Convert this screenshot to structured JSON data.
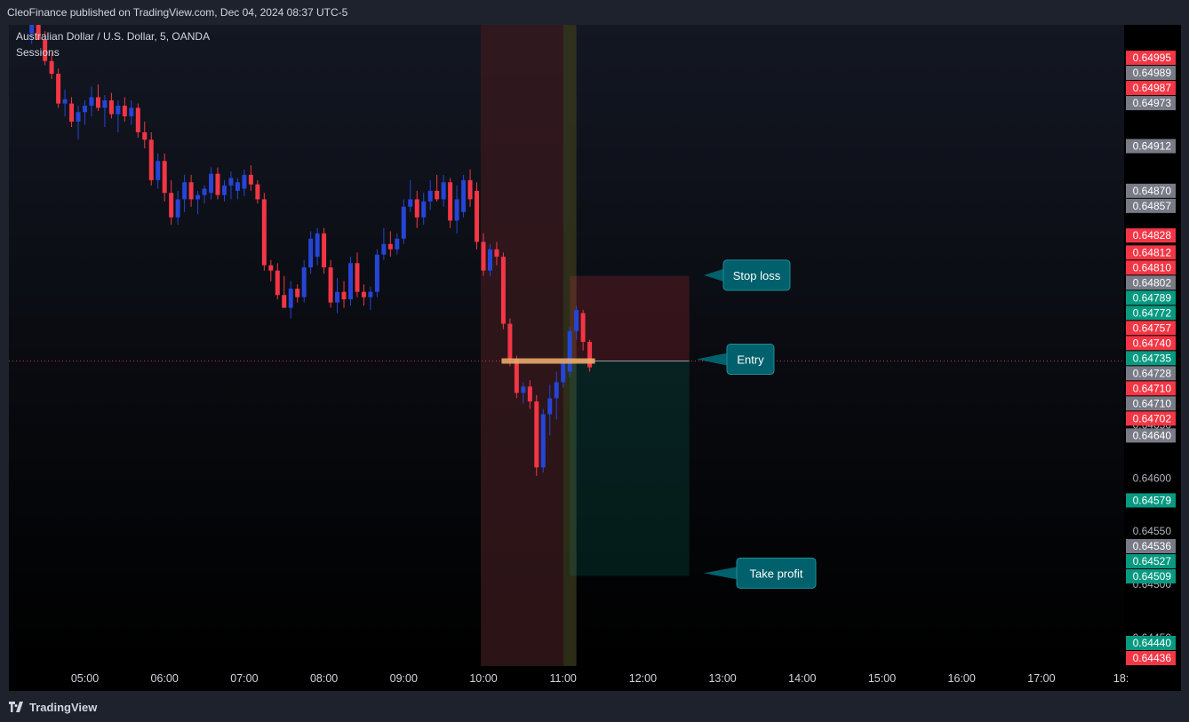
{
  "header": {
    "published": "CleoFinance published on TradingView.com, Dec 04, 2024 08:37 UTC-5"
  },
  "legend": {
    "symbol": "Australian Dollar / U.S. Dollar, 5, OANDA",
    "indicator": "Sessions"
  },
  "footer": {
    "brand": "TradingView"
  },
  "colors": {
    "up": "#2545d6",
    "down": "#f23645",
    "background_top": "#131722",
    "background_bottom": "#000000",
    "annotation": "#00606b",
    "price_gray": "#787b86",
    "price_red": "#f23645",
    "price_green": "#089981"
  },
  "chart_data": {
    "type": "candlestick",
    "symbol": "Australian Dollar / U.S. Dollar",
    "interval_minutes": 5,
    "ylim": [
      0.6443,
      0.6503
    ],
    "x_ticks": [
      "05:00",
      "06:00",
      "07:00",
      "08:00",
      "09:00",
      "10:00",
      "11:00",
      "12:00",
      "13:00",
      "14:00",
      "15:00",
      "16:00",
      "17:00",
      "18:"
    ],
    "y_ticks": [
      "0.64950",
      "0.64650",
      "0.64600",
      "0.64550",
      "0.64500",
      "0.64450"
    ],
    "candles": [
      {
        "t": "04:20",
        "o": 0.65018,
        "h": 0.65032,
        "l": 0.65008,
        "c": 0.65027
      },
      {
        "t": "04:25",
        "o": 0.6503,
        "h": 0.6504,
        "l": 0.65015,
        "c": 0.65012
      },
      {
        "t": "04:30",
        "o": 0.65012,
        "h": 0.6502,
        "l": 0.64988,
        "c": 0.64992
      },
      {
        "t": "04:35",
        "o": 0.64992,
        "h": 0.65,
        "l": 0.64975,
        "c": 0.6498
      },
      {
        "t": "04:40",
        "o": 0.6498,
        "h": 0.64985,
        "l": 0.64948,
        "c": 0.64952
      },
      {
        "t": "04:45",
        "o": 0.64952,
        "h": 0.64965,
        "l": 0.6494,
        "c": 0.64956
      },
      {
        "t": "04:50",
        "o": 0.64952,
        "h": 0.64958,
        "l": 0.6493,
        "c": 0.64935
      },
      {
        "t": "04:55",
        "o": 0.64935,
        "h": 0.6495,
        "l": 0.64918,
        "c": 0.64944
      },
      {
        "t": "05:00",
        "o": 0.64944,
        "h": 0.64955,
        "l": 0.64932,
        "c": 0.6495
      },
      {
        "t": "05:05",
        "o": 0.6495,
        "h": 0.64968,
        "l": 0.6494,
        "c": 0.64958
      },
      {
        "t": "05:10",
        "o": 0.64958,
        "h": 0.6497,
        "l": 0.64945,
        "c": 0.64948
      },
      {
        "t": "05:15",
        "o": 0.64948,
        "h": 0.6496,
        "l": 0.6493,
        "c": 0.64955
      },
      {
        "t": "05:20",
        "o": 0.64955,
        "h": 0.64962,
        "l": 0.64938,
        "c": 0.64942
      },
      {
        "t": "05:25",
        "o": 0.64942,
        "h": 0.64955,
        "l": 0.64925,
        "c": 0.6495
      },
      {
        "t": "05:30",
        "o": 0.6495,
        "h": 0.64958,
        "l": 0.64935,
        "c": 0.6494
      },
      {
        "t": "05:35",
        "o": 0.6494,
        "h": 0.64955,
        "l": 0.64932,
        "c": 0.64948
      },
      {
        "t": "05:40",
        "o": 0.64948,
        "h": 0.64952,
        "l": 0.6492,
        "c": 0.64925
      },
      {
        "t": "05:45",
        "o": 0.64925,
        "h": 0.64935,
        "l": 0.6491,
        "c": 0.64918
      },
      {
        "t": "05:50",
        "o": 0.64918,
        "h": 0.64925,
        "l": 0.64875,
        "c": 0.6488
      },
      {
        "t": "05:55",
        "o": 0.6488,
        "h": 0.64905,
        "l": 0.64872,
        "c": 0.64898
      },
      {
        "t": "06:00",
        "o": 0.64898,
        "h": 0.64905,
        "l": 0.6486,
        "c": 0.64868
      },
      {
        "t": "06:05",
        "o": 0.64868,
        "h": 0.6488,
        "l": 0.64838,
        "c": 0.64845
      },
      {
        "t": "06:10",
        "o": 0.64845,
        "h": 0.6487,
        "l": 0.64838,
        "c": 0.64862
      },
      {
        "t": "06:15",
        "o": 0.64862,
        "h": 0.64885,
        "l": 0.6485,
        "c": 0.64878
      },
      {
        "t": "06:20",
        "o": 0.64878,
        "h": 0.64885,
        "l": 0.64855,
        "c": 0.64862
      },
      {
        "t": "06:25",
        "o": 0.64862,
        "h": 0.6487,
        "l": 0.64848,
        "c": 0.64866
      },
      {
        "t": "06:30",
        "o": 0.64866,
        "h": 0.64875,
        "l": 0.64858,
        "c": 0.64872
      },
      {
        "t": "06:35",
        "o": 0.64868,
        "h": 0.64892,
        "l": 0.64862,
        "c": 0.64886
      },
      {
        "t": "06:40",
        "o": 0.64886,
        "h": 0.64892,
        "l": 0.64862,
        "c": 0.64866
      },
      {
        "t": "06:45",
        "o": 0.64866,
        "h": 0.6488,
        "l": 0.6486,
        "c": 0.64875
      },
      {
        "t": "06:50",
        "o": 0.64875,
        "h": 0.64888,
        "l": 0.64862,
        "c": 0.64882
      },
      {
        "t": "06:55",
        "o": 0.6487,
        "h": 0.64882,
        "l": 0.64862,
        "c": 0.64878
      },
      {
        "t": "07:00",
        "o": 0.64872,
        "h": 0.6489,
        "l": 0.64865,
        "c": 0.64885
      },
      {
        "t": "07:05",
        "o": 0.64885,
        "h": 0.64894,
        "l": 0.6487,
        "c": 0.64876
      },
      {
        "t": "07:10",
        "o": 0.64876,
        "h": 0.6488,
        "l": 0.64858,
        "c": 0.64862
      },
      {
        "t": "07:15",
        "o": 0.64862,
        "h": 0.64868,
        "l": 0.64795,
        "c": 0.648
      },
      {
        "t": "07:20",
        "o": 0.648,
        "h": 0.64805,
        "l": 0.64785,
        "c": 0.64795
      },
      {
        "t": "07:25",
        "o": 0.64795,
        "h": 0.64802,
        "l": 0.64768,
        "c": 0.64772
      },
      {
        "t": "07:30",
        "o": 0.64772,
        "h": 0.6479,
        "l": 0.64765,
        "c": 0.6476
      },
      {
        "t": "07:35",
        "o": 0.6476,
        "h": 0.64785,
        "l": 0.6475,
        "c": 0.64778
      },
      {
        "t": "07:40",
        "o": 0.64778,
        "h": 0.64782,
        "l": 0.64765,
        "c": 0.6477
      },
      {
        "t": "07:45",
        "o": 0.6477,
        "h": 0.64805,
        "l": 0.64765,
        "c": 0.64798
      },
      {
        "t": "07:50",
        "o": 0.64798,
        "h": 0.64832,
        "l": 0.64792,
        "c": 0.64825
      },
      {
        "t": "07:55",
        "o": 0.64808,
        "h": 0.64835,
        "l": 0.648,
        "c": 0.6483
      },
      {
        "t": "08:00",
        "o": 0.6483,
        "h": 0.64835,
        "l": 0.64792,
        "c": 0.64798
      },
      {
        "t": "08:05",
        "o": 0.64798,
        "h": 0.64805,
        "l": 0.6476,
        "c": 0.64765
      },
      {
        "t": "08:10",
        "o": 0.64765,
        "h": 0.64788,
        "l": 0.64755,
        "c": 0.64775
      },
      {
        "t": "08:15",
        "o": 0.64775,
        "h": 0.64785,
        "l": 0.6476,
        "c": 0.64768
      },
      {
        "t": "08:20",
        "o": 0.64768,
        "h": 0.64808,
        "l": 0.64762,
        "c": 0.64802
      },
      {
        "t": "08:25",
        "o": 0.64802,
        "h": 0.64812,
        "l": 0.6477,
        "c": 0.64775
      },
      {
        "t": "08:30",
        "o": 0.64775,
        "h": 0.64782,
        "l": 0.64762,
        "c": 0.6477
      },
      {
        "t": "08:35",
        "o": 0.6477,
        "h": 0.6478,
        "l": 0.64758,
        "c": 0.64775
      },
      {
        "t": "08:40",
        "o": 0.64775,
        "h": 0.64815,
        "l": 0.6477,
        "c": 0.6481
      },
      {
        "t": "08:45",
        "o": 0.6481,
        "h": 0.64835,
        "l": 0.64805,
        "c": 0.6482
      },
      {
        "t": "08:50",
        "o": 0.6482,
        "h": 0.64832,
        "l": 0.64808,
        "c": 0.64815
      },
      {
        "t": "08:55",
        "o": 0.64815,
        "h": 0.6483,
        "l": 0.6481,
        "c": 0.64825
      },
      {
        "t": "09:00",
        "o": 0.64825,
        "h": 0.64862,
        "l": 0.6482,
        "c": 0.64855
      },
      {
        "t": "09:05",
        "o": 0.64855,
        "h": 0.6488,
        "l": 0.6485,
        "c": 0.64862
      },
      {
        "t": "09:10",
        "o": 0.64862,
        "h": 0.6487,
        "l": 0.64835,
        "c": 0.64845
      },
      {
        "t": "09:15",
        "o": 0.64845,
        "h": 0.64868,
        "l": 0.64838,
        "c": 0.6486
      },
      {
        "t": "09:20",
        "o": 0.6486,
        "h": 0.6488,
        "l": 0.64852,
        "c": 0.6487
      },
      {
        "t": "09:25",
        "o": 0.6487,
        "h": 0.64885,
        "l": 0.6486,
        "c": 0.64862
      },
      {
        "t": "09:30",
        "o": 0.64862,
        "h": 0.64885,
        "l": 0.64855,
        "c": 0.64878
      },
      {
        "t": "09:35",
        "o": 0.64878,
        "h": 0.64882,
        "l": 0.64835,
        "c": 0.64842
      },
      {
        "t": "09:40",
        "o": 0.64842,
        "h": 0.64875,
        "l": 0.6483,
        "c": 0.64862
      },
      {
        "t": "09:45",
        "o": 0.6485,
        "h": 0.64885,
        "l": 0.64845,
        "c": 0.6488
      },
      {
        "t": "09:50",
        "o": 0.6488,
        "h": 0.6489,
        "l": 0.64855,
        "c": 0.64862
      },
      {
        "t": "09:55",
        "o": 0.6487,
        "h": 0.64878,
        "l": 0.64815,
        "c": 0.64822
      },
      {
        "t": "10:00",
        "o": 0.64822,
        "h": 0.6483,
        "l": 0.6479,
        "c": 0.64795
      },
      {
        "t": "10:05",
        "o": 0.64795,
        "h": 0.6482,
        "l": 0.6479,
        "c": 0.64815
      },
      {
        "t": "10:10",
        "o": 0.64815,
        "h": 0.64822,
        "l": 0.648,
        "c": 0.64808
      },
      {
        "t": "10:15",
        "o": 0.64808,
        "h": 0.64812,
        "l": 0.6474,
        "c": 0.64745
      },
      {
        "t": "10:20",
        "o": 0.64745,
        "h": 0.6475,
        "l": 0.64705,
        "c": 0.64712
      },
      {
        "t": "10:25",
        "o": 0.64712,
        "h": 0.64715,
        "l": 0.64675,
        "c": 0.6468
      },
      {
        "t": "10:30",
        "o": 0.6468,
        "h": 0.6469,
        "l": 0.6467,
        "c": 0.64686
      },
      {
        "t": "10:35",
        "o": 0.64686,
        "h": 0.64692,
        "l": 0.64665,
        "c": 0.64672
      },
      {
        "t": "10:40",
        "o": 0.64672,
        "h": 0.64678,
        "l": 0.64602,
        "c": 0.6461
      },
      {
        "t": "10:45",
        "o": 0.6461,
        "h": 0.64665,
        "l": 0.64605,
        "c": 0.6466
      },
      {
        "t": "10:50",
        "o": 0.6466,
        "h": 0.64688,
        "l": 0.6464,
        "c": 0.64675
      },
      {
        "t": "10:55",
        "o": 0.64675,
        "h": 0.647,
        "l": 0.64655,
        "c": 0.6469
      },
      {
        "t": "11:00",
        "o": 0.6469,
        "h": 0.64712,
        "l": 0.64685,
        "c": 0.64708
      },
      {
        "t": "11:05",
        "o": 0.647,
        "h": 0.64742,
        "l": 0.64695,
        "c": 0.64738
      },
      {
        "t": "11:10",
        "o": 0.64738,
        "h": 0.64762,
        "l": 0.6473,
        "c": 0.64758
      },
      {
        "t": "11:15",
        "o": 0.64755,
        "h": 0.64758,
        "l": 0.6472,
        "c": 0.64728
      },
      {
        "t": "11:20",
        "o": 0.64728,
        "h": 0.6473,
        "l": 0.647,
        "c": 0.64704
      }
    ],
    "x_start": "04:20",
    "pixels_per_hour_note": "",
    "current_price": 0.6471,
    "position": {
      "entry": 0.6471,
      "stop_loss": 0.6479,
      "take_profit": 0.64508,
      "start": "11:05",
      "end": "12:35"
    },
    "sessions": [
      {
        "from": "09:58",
        "to": "11:00",
        "color": "#3a1a1e"
      },
      {
        "from": "11:00",
        "to": "11:10",
        "color": "#3a3a1e"
      }
    ],
    "annotations": [
      {
        "label": "Stop loss",
        "price": 0.64789
      },
      {
        "label": "Entry",
        "price": 0.6471
      },
      {
        "label": "Take profit",
        "price": 0.64509
      }
    ],
    "price_labels": [
      {
        "text": "0.64995",
        "color": "red"
      },
      {
        "text": "0.64989",
        "color": "gray"
      },
      {
        "text": "0.64987",
        "color": "red"
      },
      {
        "text": "0.64973",
        "color": "gray"
      },
      {
        "text": "0.64912",
        "color": "gray"
      },
      {
        "text": "0.64870",
        "color": "gray"
      },
      {
        "text": "0.64857",
        "color": "gray"
      },
      {
        "text": "0.64828",
        "color": "red"
      },
      {
        "text": "0.64812",
        "color": "red"
      },
      {
        "text": "0.64810",
        "color": "red"
      },
      {
        "text": "0.64802",
        "color": "gray"
      },
      {
        "text": "0.64789",
        "color": "green"
      },
      {
        "text": "0.64772",
        "color": "green"
      },
      {
        "text": "0.64757",
        "color": "red"
      },
      {
        "text": "0.64740",
        "color": "red"
      },
      {
        "text": "0.64735",
        "color": "green"
      },
      {
        "text": "0.64728",
        "color": "gray"
      },
      {
        "text": "0.64710",
        "color": "red"
      },
      {
        "text": "0.64710",
        "color": "gray"
      },
      {
        "text": "0.64702",
        "color": "red"
      },
      {
        "text": "0.64640",
        "color": "gray"
      },
      {
        "text": "0.64579",
        "color": "green"
      },
      {
        "text": "0.64536",
        "color": "gray"
      },
      {
        "text": "0.64527",
        "color": "green"
      },
      {
        "text": "0.64509",
        "color": "green"
      },
      {
        "text": "0.64440",
        "color": "green"
      },
      {
        "text": "0.64436",
        "color": "red"
      }
    ]
  }
}
